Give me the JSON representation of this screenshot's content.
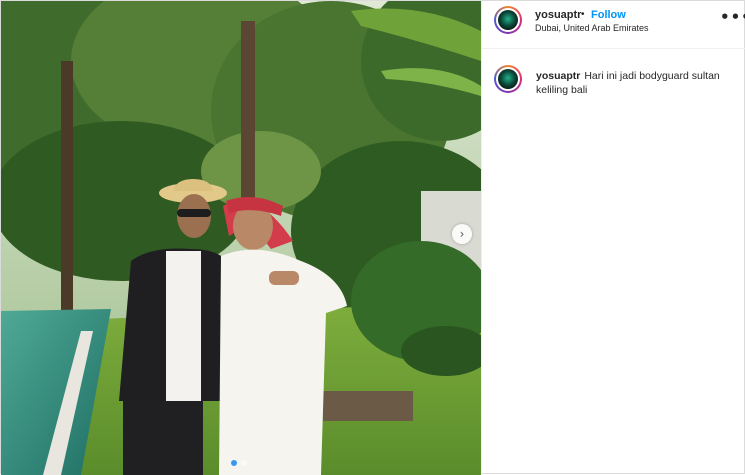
{
  "post": {
    "username": "yosuaptr",
    "separator": "•",
    "follow_label": "Follow",
    "location": "Dubai, United Arab Emirates",
    "more_icon": "more-horizontal-icon",
    "more_label": "•••"
  },
  "caption": {
    "username": "yosuaptr",
    "text": "Hari ini jadi bodyguard sultan keliling bali"
  },
  "carousel": {
    "next_icon": "chevron-right-icon",
    "next_glyph": "›",
    "slides": 2,
    "current": 1
  },
  "colors": {
    "accent": "#0095f6",
    "active_dot": "#3897f0",
    "text": "#262626"
  }
}
